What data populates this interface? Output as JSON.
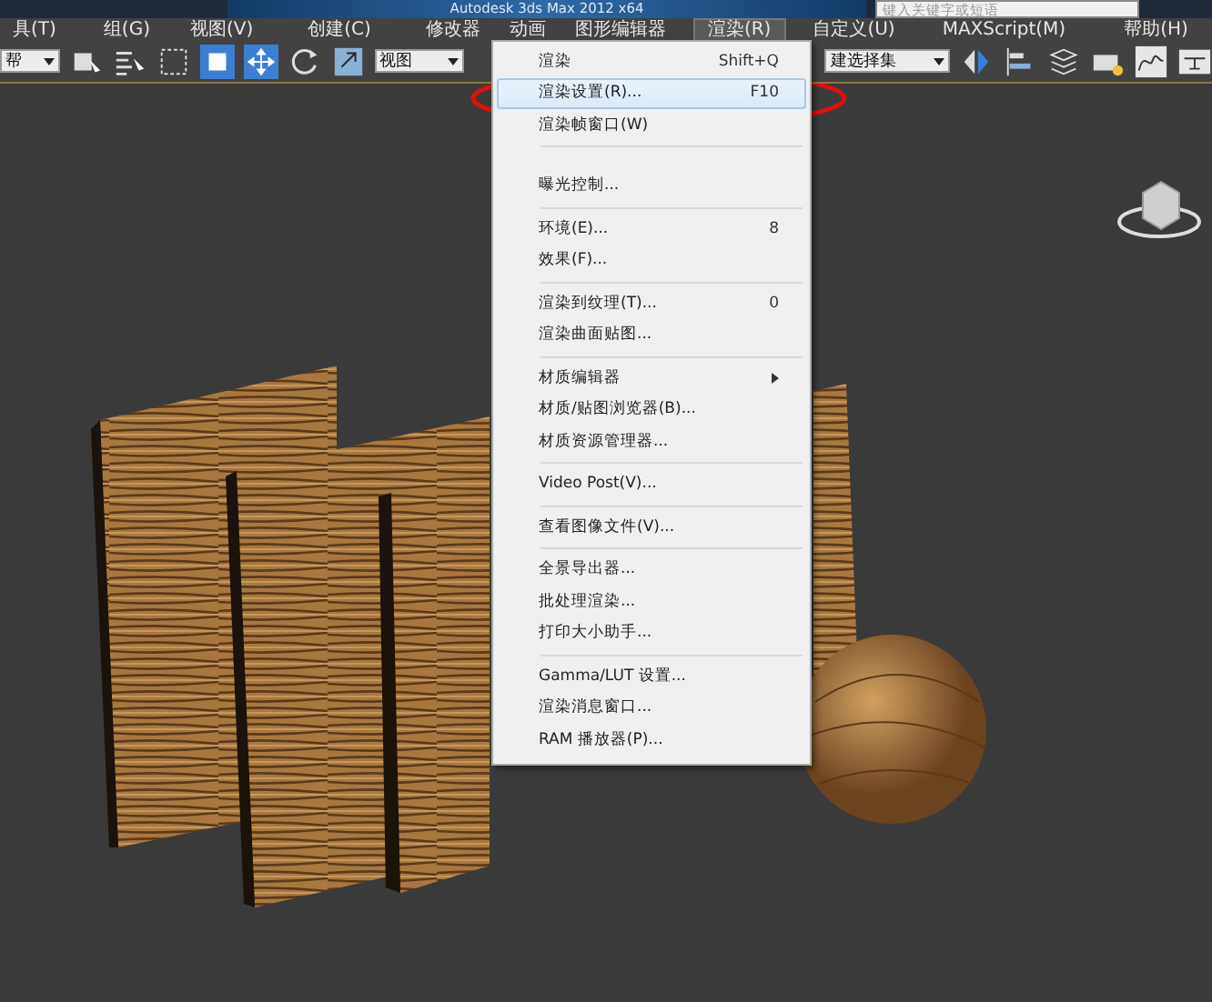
{
  "window": {
    "title": "Autodesk 3ds Max  2012 x64"
  },
  "search": {
    "placeholder": "键入关键字或短语"
  },
  "menubar": [
    {
      "label": "具(T)",
      "selected": false
    },
    {
      "label": "组(G)",
      "selected": false
    },
    {
      "label": "视图(V)",
      "selected": false
    },
    {
      "label": "创建(C)",
      "selected": false
    },
    {
      "label": "修改器",
      "selected": false
    },
    {
      "label": "动画",
      "selected": false
    },
    {
      "label": "图形编辑器",
      "selected": false
    },
    {
      "label": "渲染(R)",
      "selected": true
    },
    {
      "label": "自定义(U)",
      "selected": false
    },
    {
      "label": "MAXScript(M)",
      "selected": false
    },
    {
      "label": "帮助(H)",
      "selected": false
    }
  ],
  "toolbar": {
    "layer_dropdown": "帮",
    "view_dropdown": "视图",
    "selection_set_dropdown": "建选择集"
  },
  "render_menu": {
    "groups": [
      [
        {
          "label": "渲染",
          "shortcut": "Shift+Q",
          "submenu": false,
          "selected": false
        },
        {
          "label": "渲染设置(R)...",
          "shortcut": "F10",
          "submenu": false,
          "selected": true
        },
        {
          "label": "渲染帧窗口(W)",
          "submenu": false,
          "selected": false
        }
      ],
      [
        {
          "label": "曝光控制...",
          "submenu": false,
          "selected": false
        }
      ],
      [
        {
          "label": "环境(E)...",
          "shortcut": "8",
          "submenu": false,
          "selected": false
        },
        {
          "label": "效果(F)...",
          "submenu": false,
          "selected": false
        }
      ],
      [
        {
          "label": "渲染到纹理(T)...",
          "shortcut": "0",
          "submenu": false,
          "selected": false
        },
        {
          "label": "渲染曲面贴图...",
          "submenu": false,
          "selected": false
        }
      ],
      [
        {
          "label": "材质编辑器",
          "submenu": true,
          "selected": false
        },
        {
          "label": "材质/贴图浏览器(B)...",
          "submenu": false,
          "selected": false
        },
        {
          "label": "材质资源管理器...",
          "submenu": false,
          "selected": false
        }
      ],
      [
        {
          "label": "Video Post(V)...",
          "submenu": false,
          "selected": false
        }
      ],
      [
        {
          "label": "查看图像文件(V)...",
          "submenu": false,
          "selected": false
        }
      ],
      [
        {
          "label": "全景导出器...",
          "submenu": false,
          "selected": false
        },
        {
          "label": "批处理渲染...",
          "submenu": false,
          "selected": false
        },
        {
          "label": "打印大小助手...",
          "submenu": false,
          "selected": false
        }
      ],
      [
        {
          "label": "Gamma/LUT 设置...",
          "submenu": false,
          "selected": false
        },
        {
          "label": "渲染消息窗口...",
          "submenu": false,
          "selected": false
        },
        {
          "label": "RAM 播放器(P)...",
          "submenu": false,
          "selected": false
        }
      ]
    ]
  }
}
